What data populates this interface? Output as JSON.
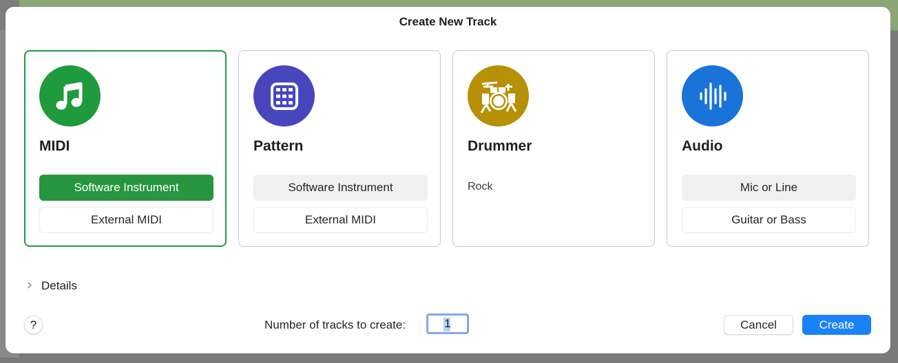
{
  "dialog": {
    "title": "Create New Track"
  },
  "cards": [
    {
      "id": "midi",
      "title": "MIDI",
      "icon": "music-note-icon",
      "icon_color": "#1f9a3c",
      "selected": true,
      "options": [
        {
          "label": "Software Instrument",
          "state": "selected"
        },
        {
          "label": "External MIDI",
          "state": "normal"
        }
      ]
    },
    {
      "id": "pattern",
      "title": "Pattern",
      "icon": "grid-pad-icon",
      "icon_color": "#4846bd",
      "selected": false,
      "options": [
        {
          "label": "Software Instrument",
          "state": "highlighted"
        },
        {
          "label": "External MIDI",
          "state": "normal"
        }
      ]
    },
    {
      "id": "drummer",
      "title": "Drummer",
      "icon": "drum-kit-icon",
      "icon_color": "#b69007",
      "selected": false,
      "genre": "Rock"
    },
    {
      "id": "audio",
      "title": "Audio",
      "icon": "waveform-icon",
      "icon_color": "#1a73d9",
      "selected": false,
      "options": [
        {
          "label": "Mic or Line",
          "state": "highlighted"
        },
        {
          "label": "Guitar or Bass",
          "state": "normal"
        }
      ]
    }
  ],
  "details": {
    "label": "Details",
    "expanded": false
  },
  "help": {
    "label": "?"
  },
  "track_count": {
    "label": "Number of tracks to create:",
    "value": "1"
  },
  "buttons": {
    "cancel": "Cancel",
    "create": "Create"
  },
  "colors": {
    "selection_green": "#27963f",
    "accent_blue": "#1a82fb",
    "focus_ring": "#7fa8f0"
  }
}
